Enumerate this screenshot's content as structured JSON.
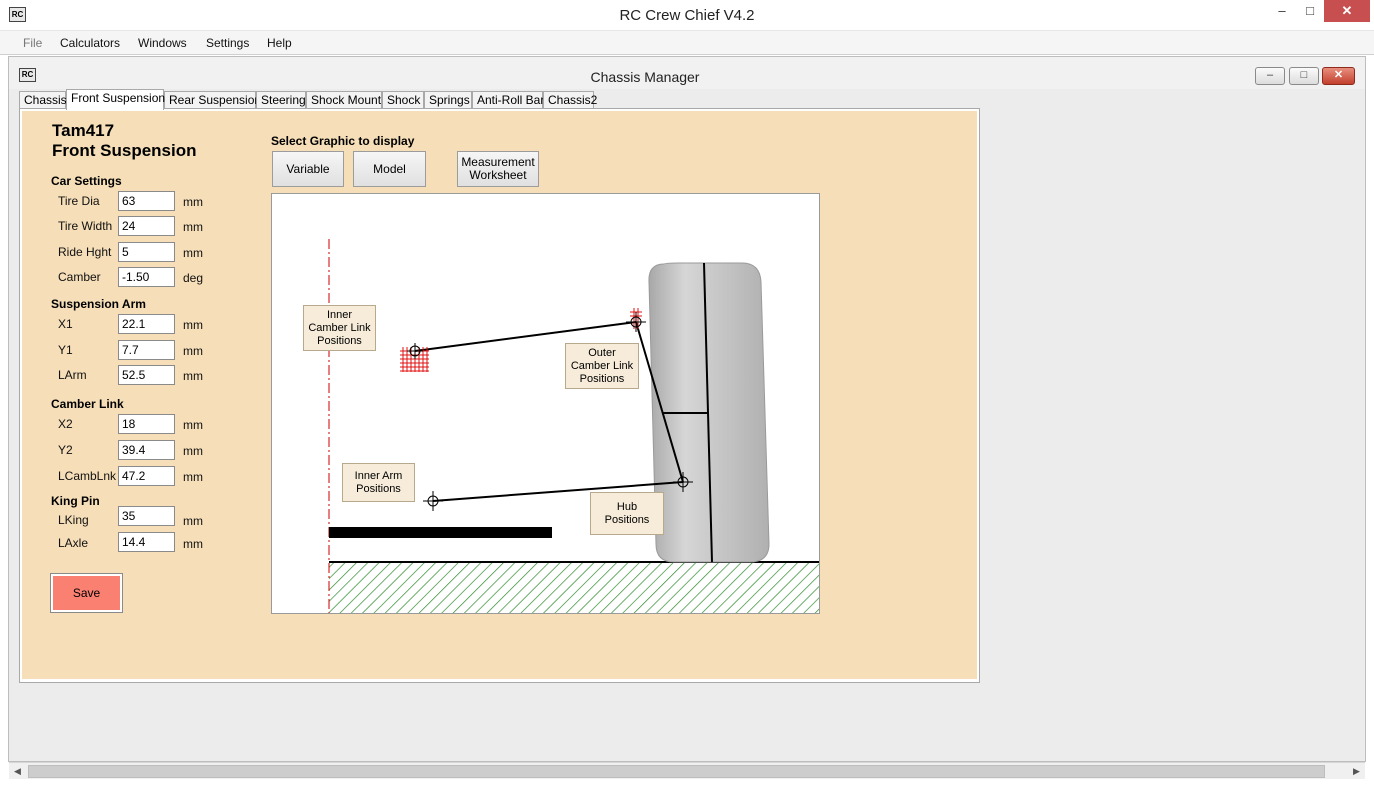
{
  "app": {
    "icon_text": "RC",
    "title": "RC Crew Chief V4.2",
    "window_buttons": {
      "minimize": "–",
      "maximize": "□",
      "close": "✕"
    }
  },
  "menu": [
    "File",
    "Calculators",
    "Windows",
    "Settings",
    "Help"
  ],
  "child_window": {
    "icon_text": "RC",
    "title": "Chassis Manager",
    "buttons": {
      "minimize": "–",
      "maximize": "□",
      "close": "✕"
    }
  },
  "tabs": [
    "Chassis",
    "Front Suspension",
    "Rear Suspension",
    "Steering",
    "Shock Mount",
    "Shock",
    "Springs",
    "Anti-Roll Bar",
    "Chassis2"
  ],
  "active_tab": "Front Suspension",
  "panel": {
    "model": "Tam417",
    "section": "Front Suspension",
    "groups": {
      "car_settings": "Car Settings",
      "suspension_arm": "Suspension Arm",
      "camber_link": "Camber Link",
      "king_pin": "King Pin"
    },
    "fields": {
      "tire_dia": {
        "label": "Tire Dia",
        "value": "63",
        "unit": "mm"
      },
      "tire_width": {
        "label": "Tire Width",
        "value": "24",
        "unit": "mm"
      },
      "ride_hght": {
        "label": "Ride Hght",
        "value": "5",
        "unit": "mm"
      },
      "camber": {
        "label": "Camber",
        "value": "-1.50",
        "unit": "deg"
      },
      "x1": {
        "label": "X1",
        "value": "22.1",
        "unit": "mm"
      },
      "y1": {
        "label": "Y1",
        "value": "7.7",
        "unit": "mm"
      },
      "larm": {
        "label": "LArm",
        "value": "52.5",
        "unit": "mm"
      },
      "x2": {
        "label": "X2",
        "value": "18",
        "unit": "mm"
      },
      "y2": {
        "label": "Y2",
        "value": "39.4",
        "unit": "mm"
      },
      "lcamblnk": {
        "label": "LCambLnk",
        "value": "47.2",
        "unit": "mm"
      },
      "lking": {
        "label": "LKing",
        "value": "35",
        "unit": "mm"
      },
      "laxle": {
        "label": "LAxle",
        "value": "14.4",
        "unit": "mm"
      }
    },
    "save_label": "Save",
    "select_graphic_label": "Select Graphic to display",
    "graphic_buttons": {
      "variable": "Variable",
      "model": "Model",
      "measurement_line1": "Measurement",
      "measurement_line2": "Worksheet"
    }
  },
  "diagram": {
    "inner_camber": [
      "Inner",
      "Camber Link",
      "Positions"
    ],
    "outer_camber": [
      "Outer",
      "Camber Link",
      "Positions"
    ],
    "inner_arm": [
      "Inner Arm",
      "Positions"
    ],
    "hub": [
      "Hub",
      "Positions"
    ],
    "colors": {
      "centerline": "#cc0000",
      "ground_hatch": "#2e8b2e",
      "tire": "#bdbdbd"
    }
  },
  "scrollbar": {
    "left_arrow": "◀",
    "right_arrow": "▶"
  }
}
